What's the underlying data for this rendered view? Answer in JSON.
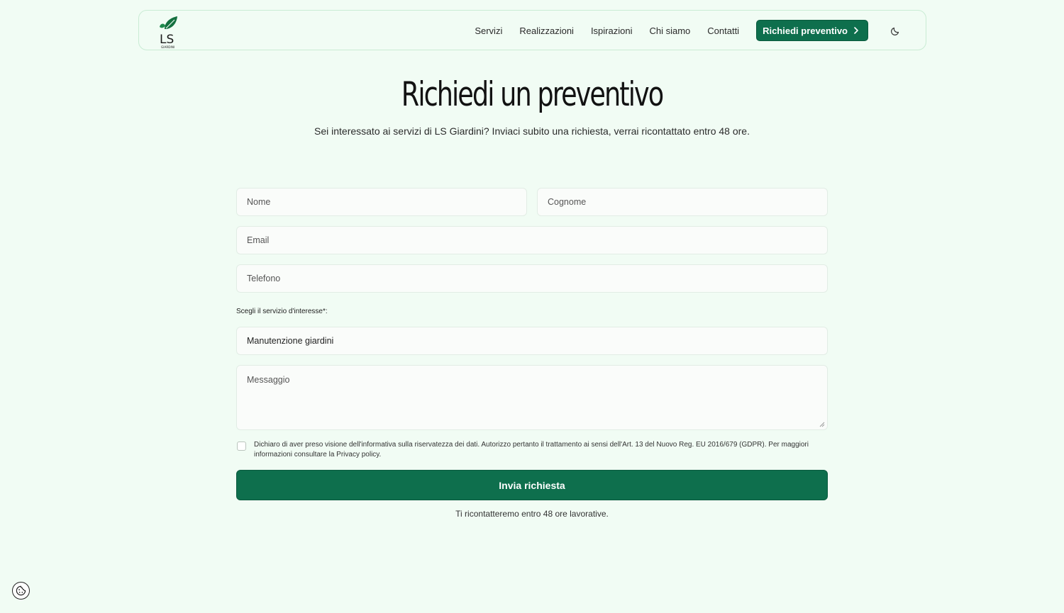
{
  "header": {
    "logo_text": "LS",
    "logo_subtext": "GIARDINI",
    "nav": [
      {
        "label": "Servizi"
      },
      {
        "label": "Realizzazioni"
      },
      {
        "label": "Ispirazioni"
      },
      {
        "label": "Chi siamo"
      },
      {
        "label": "Contatti"
      }
    ],
    "cta_label": "Richiedi preventivo",
    "theme_icon": "moon-icon"
  },
  "hero": {
    "title": "Richiedi un preventivo",
    "subtitle": "Sei interessato ai servizi di LS Giardini? Inviaci subito una richiesta, verrai ricontattato entro 48 ore."
  },
  "form": {
    "nome_placeholder": "Nome",
    "cognome_placeholder": "Cognome",
    "email_placeholder": "Email",
    "telefono_placeholder": "Telefono",
    "service_label": "Scegli il servizio d'interesse*:",
    "service_value": "Manutenzione giardini",
    "messaggio_placeholder": "Messaggio",
    "consent_text": "Dichiaro di aver preso visione dell'informativa sulla riservatezza dei dati. Autorizzo pertanto il trattamento ai sensi dell'Art. 13 del Nuovo Reg. EU 2016/679 (GDPR). Per maggiori informazioni consultare la Privacy policy.",
    "submit_label": "Invia richiesta",
    "note": "Ti ricontatteremo entro 48 ore lavorative."
  },
  "colors": {
    "brand": "#0e6f4d",
    "background": "#f1fcf4"
  }
}
